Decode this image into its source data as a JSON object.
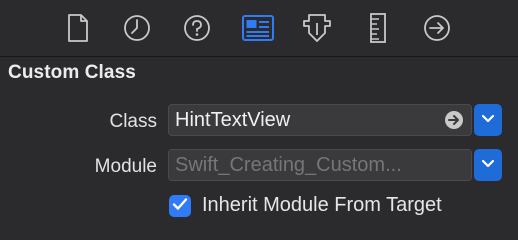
{
  "toolbar": {
    "icons": [
      "file-inspector-icon",
      "history-inspector-icon",
      "quick-help-icon",
      "identity-inspector-icon",
      "attributes-inspector-icon",
      "size-inspector-icon",
      "connections-inspector-icon"
    ],
    "selected_index": 3,
    "accent_color": "#2f7cf6"
  },
  "section": {
    "title": "Custom Class"
  },
  "fields": {
    "class_label": "Class",
    "class_value": "HintTextView",
    "module_label": "Module",
    "module_placeholder": "Swift_Creating_Custom..."
  },
  "inherit": {
    "label": "Inherit Module From Target",
    "checked": true
  }
}
